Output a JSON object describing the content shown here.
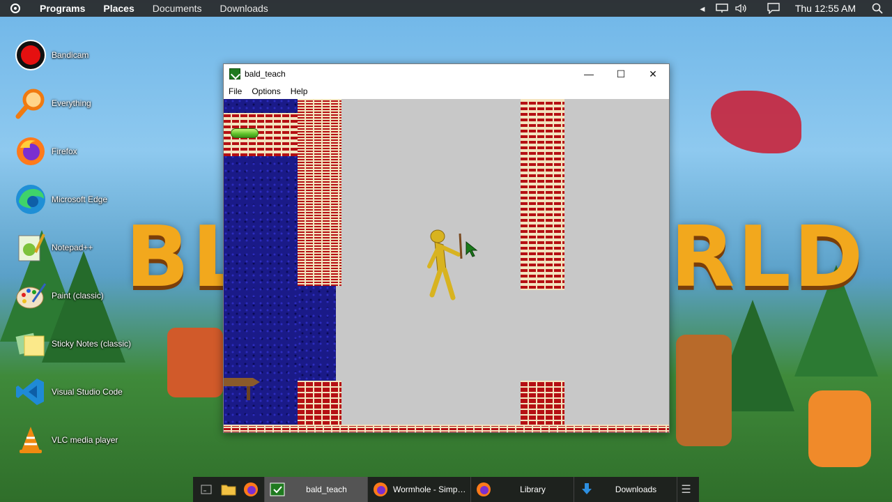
{
  "panel": {
    "menus": [
      "Programs",
      "Places",
      "Documents",
      "Downloads"
    ],
    "clock": "Thu 12:55 AM"
  },
  "wallpaper": {
    "title_left": "BL",
    "title_right": "RLD"
  },
  "desktop": {
    "icons": [
      {
        "label": "Bandicam",
        "icon": "bandicam-icon"
      },
      {
        "label": "Everything",
        "icon": "search-icon"
      },
      {
        "label": "Firefox",
        "icon": "firefox-icon"
      },
      {
        "label": "Microsoft Edge",
        "icon": "edge-icon"
      },
      {
        "label": "Notepad++",
        "icon": "notepad-icon"
      },
      {
        "label": "Paint (classic)",
        "icon": "paint-icon"
      },
      {
        "label": "Sticky Notes (classic)",
        "icon": "sticky-notes-icon"
      },
      {
        "label": "Visual Studio Code",
        "icon": "vscode-icon"
      },
      {
        "label": "VLC media player",
        "icon": "vlc-icon"
      }
    ]
  },
  "window": {
    "title": "bald_teach",
    "menu": [
      "File",
      "Options",
      "Help"
    ],
    "controls": {
      "minimize": "—",
      "maximize": "☐",
      "close": "✕"
    }
  },
  "taskbar": {
    "tasks": [
      {
        "label": "bald_teach",
        "icon": "game-icon",
        "active": true
      },
      {
        "label": "Wormhole - Simpl...",
        "icon": "firefox-icon",
        "active": false
      },
      {
        "label": "Library",
        "icon": "firefox-icon",
        "active": false
      },
      {
        "label": "Downloads",
        "icon": "download-icon",
        "active": false
      }
    ]
  },
  "colors": {
    "brick": "#b50f13",
    "mortar": "#f3e4bf",
    "water": "#1a1a88",
    "game_bg": "#c8c8c8"
  }
}
